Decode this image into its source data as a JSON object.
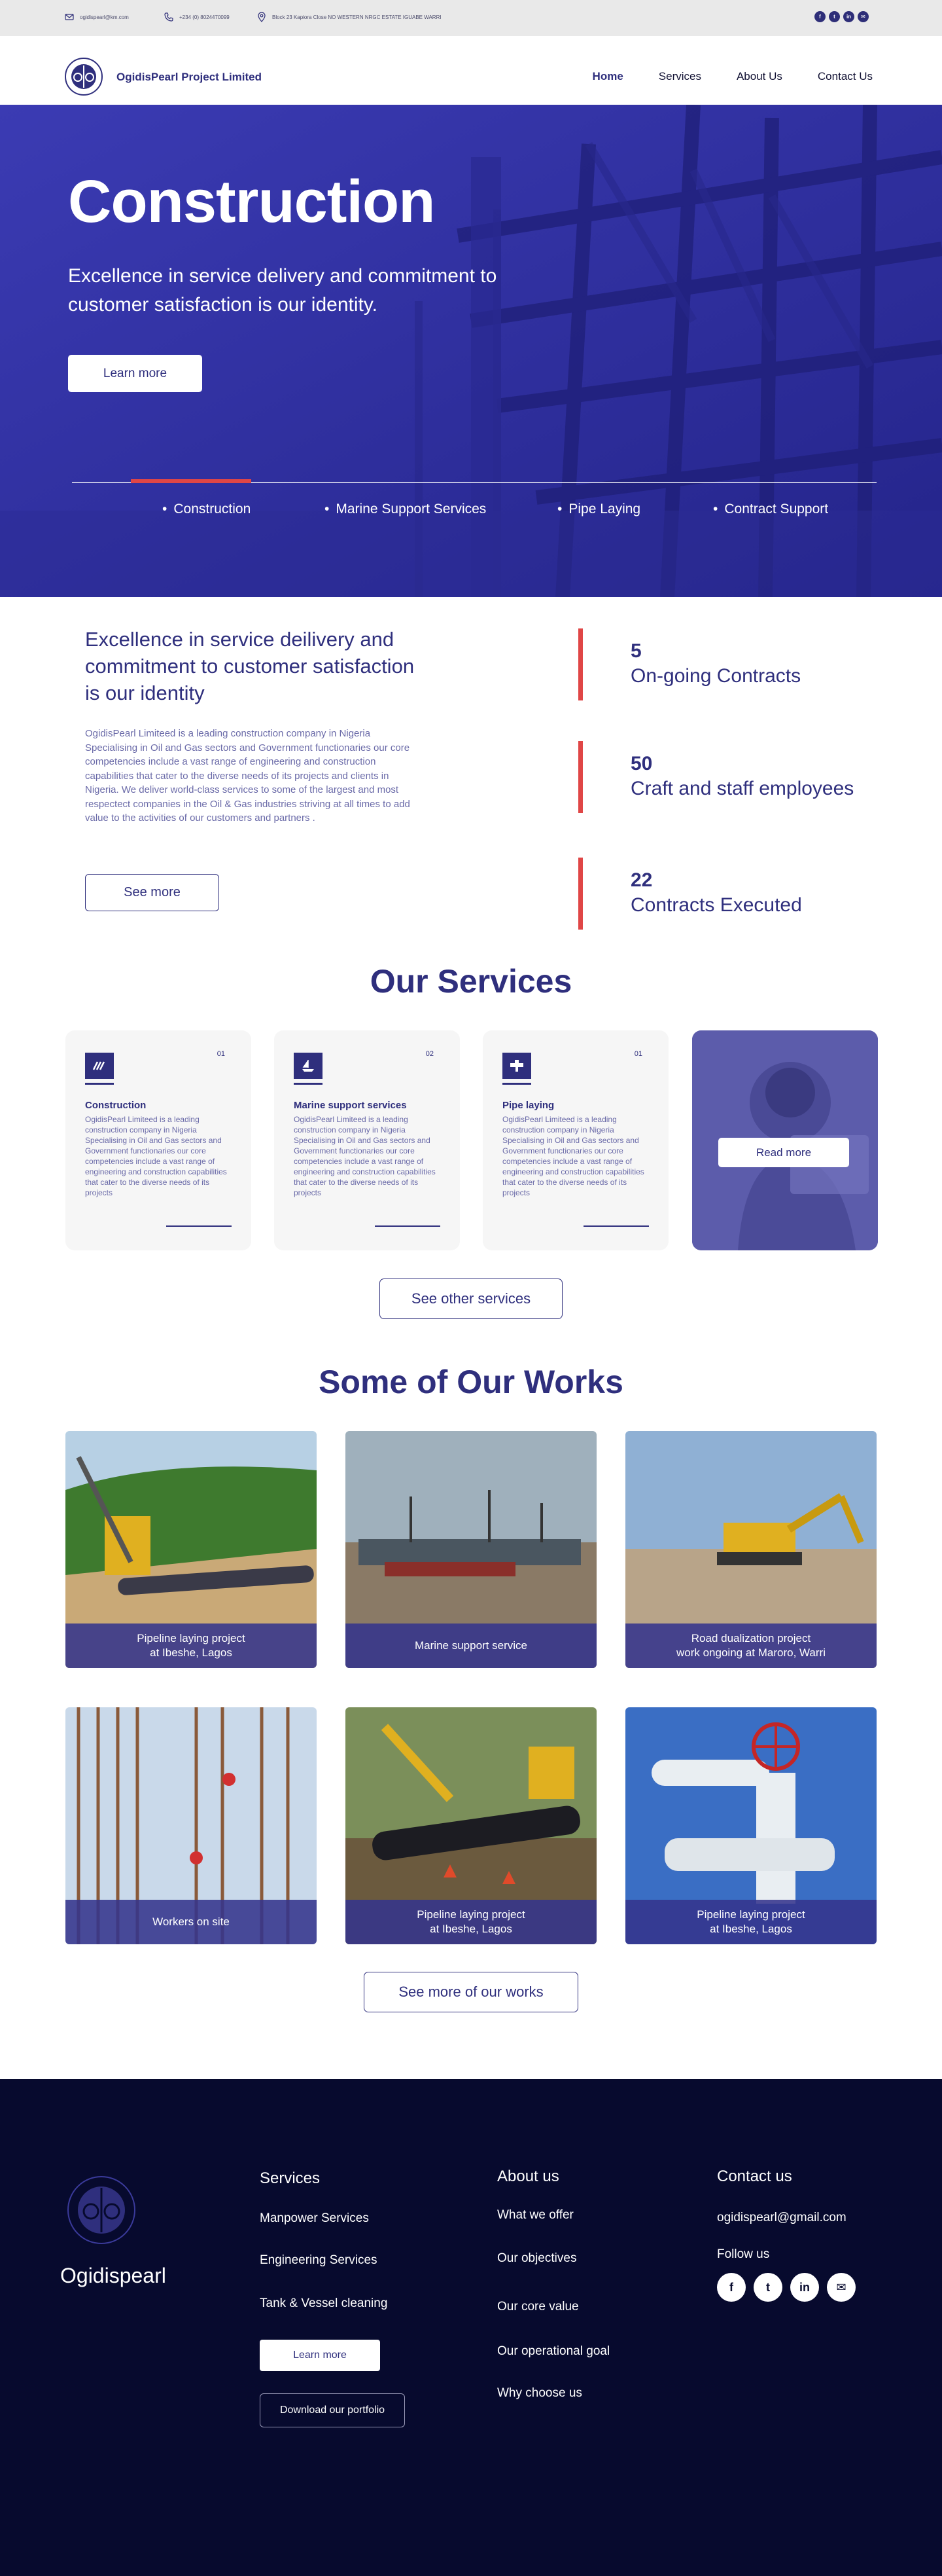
{
  "topbar": {
    "email": "ogidispearl@km.com",
    "phone": "+234 (0) 8024470099",
    "address": "Block 23 Kapiora Close NO WESTERN NRGC ESTATE IGUABE WARRI",
    "social": [
      "facebook-icon",
      "twitter-icon",
      "linkedin-icon",
      "mail-icon"
    ]
  },
  "nav": {
    "brand": "OgidisPearl Project Limited",
    "links": [
      "Home",
      "Services",
      "About Us",
      "Contact Us"
    ]
  },
  "hero": {
    "title": "Construction",
    "subtitle": "Excellence in service delivery and commitment to customer satisfaction is our identity.",
    "cta": "Learn more",
    "categories": [
      "Construction",
      "Marine Support Services",
      "Pipe Laying",
      "Contract Support"
    ]
  },
  "about": {
    "title": "Excellence in service deilivery and commitment to customer satisfaction is our identity",
    "text": "OgidisPearl Limiteed is a leading construction company in Nigeria Specialising in Oil and Gas sectors and Government functionaries our core competencies include a vast range of engineering and construction capabilities that cater to the diverse needs of its projects and clients in Nigeria. We deliver world-class services to some of the largest and most respectect companies in the Oil & Gas industries striving at all times to add value to the activities of our customers and partners .",
    "button": "See more",
    "stats": [
      {
        "num": "5",
        "label": "On-going Contracts"
      },
      {
        "num": "50",
        "label": "Craft and staff employees"
      },
      {
        "num": "22",
        "label": "Contracts Executed"
      }
    ]
  },
  "services": {
    "title": "Our Services",
    "cards": [
      {
        "no": "01",
        "title": "Construction",
        "desc": "OgidisPearl Limiteed is a leading construction company in Nigeria Specialising in Oil and Gas sectors and Government functionaries our core competencies include a vast range of engineering and construction capabilities that cater to the diverse needs of its projects",
        "icon": "construction-icon"
      },
      {
        "no": "02",
        "title": "Marine support services",
        "desc": "OgidisPearl Limiteed is a leading construction company in Nigeria Specialising in Oil and Gas sectors and Government functionaries our core competencies include a vast range of engineering and construction capabilities that cater to the diverse needs of its projects",
        "icon": "boat-icon"
      },
      {
        "no": "01",
        "title": "Pipe laying",
        "desc": "OgidisPearl Limiteed is a leading construction company in Nigeria Specialising in Oil and Gas sectors and Government functionaries our core competencies include a vast range of engineering and construction capabilities that cater to the diverse needs of its projects",
        "icon": "pipe-icon"
      }
    ],
    "read_more": "Read more",
    "other": "See other services"
  },
  "works": {
    "title": "Some of Our Works",
    "items": [
      "Pipeline laying project\nat Ibeshe, Lagos",
      "Marine support service",
      "Road dualization project\nwork ongoing at Maroro, Warri",
      "Workers on site",
      "Pipeline laying project\nat Ibeshe, Lagos",
      "Pipeline laying project\nat Ibeshe, Lagos"
    ],
    "more": "See more of our works"
  },
  "footer": {
    "brand": "Ogidispearl",
    "services_title": "Services",
    "services": [
      "Manpower Services",
      "Engineering Services",
      "Tank & Vessel cleaning"
    ],
    "learn": "Learn more",
    "portfolio": "Download our portfolio",
    "about_title": "About us",
    "about": [
      "What we offer",
      "Our objectives",
      "Our core value",
      "Our operational goal",
      "Why choose us"
    ],
    "contact_title": "Contact us",
    "email": "ogidispearl@gmail.com",
    "follow": "Follow us"
  }
}
